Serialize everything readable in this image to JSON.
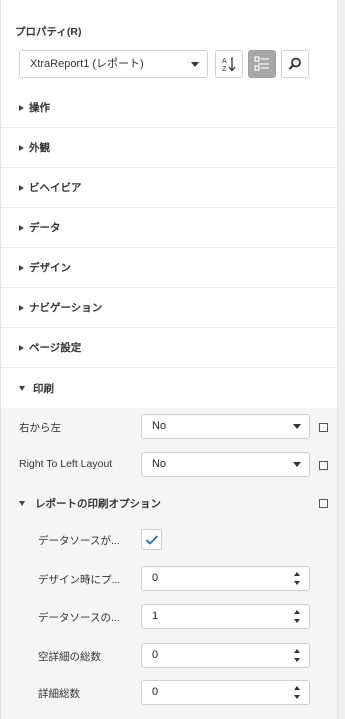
{
  "panel": {
    "title": "プロパティ(R)"
  },
  "toolbar": {
    "object_selector_value": "XtraReport1 (レポート)",
    "sort_alpha_icon": "sort-az-icon",
    "categorized_icon": "categorized-icon",
    "search_icon": "search-icon"
  },
  "categories": [
    {
      "label": "操作",
      "expanded": false
    },
    {
      "label": "外観",
      "expanded": false
    },
    {
      "label": "ビヘイビア",
      "expanded": false
    },
    {
      "label": "データ",
      "expanded": false
    },
    {
      "label": "デザイン",
      "expanded": false
    },
    {
      "label": "ナビゲーション",
      "expanded": false
    },
    {
      "label": "ページ設定",
      "expanded": false
    },
    {
      "label": "印刷",
      "expanded": true
    }
  ],
  "print": {
    "rtl": {
      "name": "右から左",
      "value": "No"
    },
    "rtl_layout": {
      "name": "Right To Left Layout",
      "value": "No"
    },
    "print_options": {
      "label": "レポートの印刷オプション",
      "datasource_empty": {
        "name": "データソースが...",
        "checked": true
      },
      "design_detail_count": {
        "name": "デザイン時にプ...",
        "value": "0"
      },
      "datasource_count": {
        "name": "データソースの...",
        "value": "1"
      },
      "empty_detail_count": {
        "name": "空詳細の総数",
        "value": "0"
      },
      "detail_count": {
        "name": "詳細総数",
        "value": "0"
      }
    }
  },
  "colors": {
    "accent": "#1f6fb2",
    "active_button": "#a8a8a8",
    "expanded_background": "#f5f5f5"
  }
}
